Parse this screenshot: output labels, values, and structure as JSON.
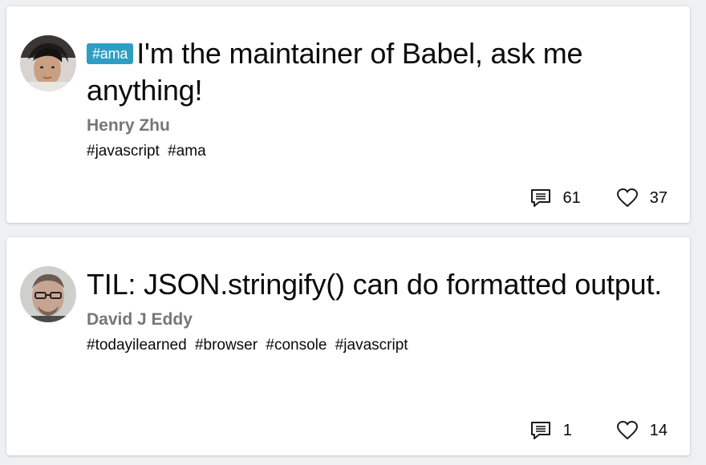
{
  "articles": [
    {
      "badge": "#ama",
      "title": "I'm the maintainer of Babel, ask me anything!",
      "author": "Henry Zhu",
      "tags": [
        "#javascript",
        "#ama"
      ],
      "comments": "61",
      "likes": "37",
      "avatar_icon": "avatar-henry"
    },
    {
      "badge": "",
      "title": "TIL: JSON.stringify() can do formatted output.",
      "author": "David J Eddy",
      "tags": [
        "#todayilearned",
        "#browser",
        "#console",
        "#javascript"
      ],
      "comments": "1",
      "likes": "14",
      "avatar_icon": "avatar-david"
    }
  ],
  "colors": {
    "badge_bg": "#2e9ec4",
    "author": "#767676",
    "background": "#eef0f1"
  }
}
